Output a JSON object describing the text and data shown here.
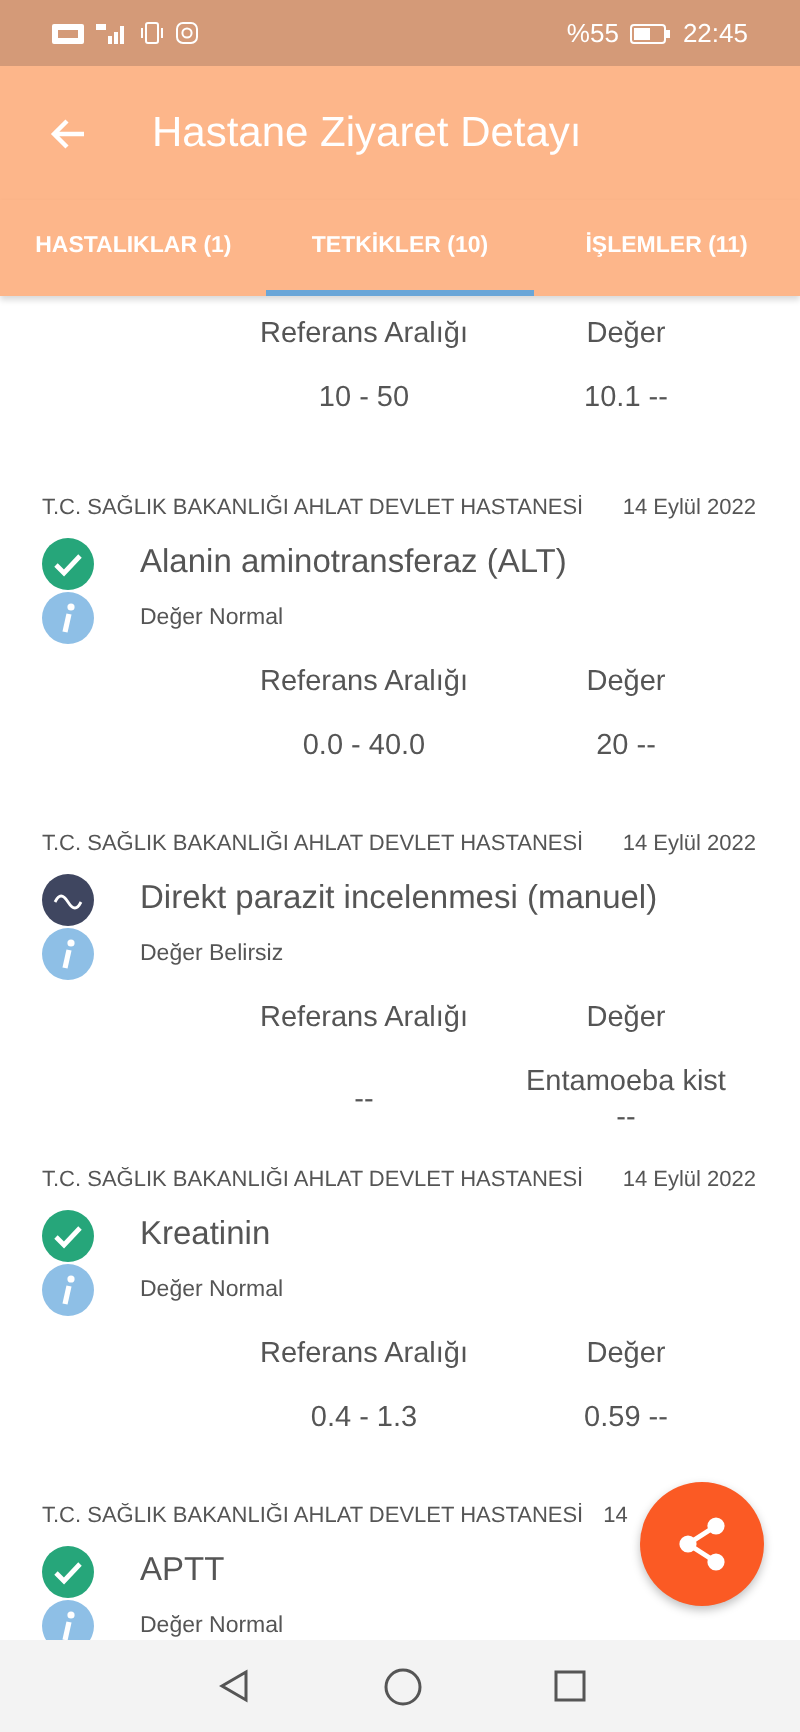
{
  "status_bar": {
    "battery": "%55",
    "time": "22:45"
  },
  "app_bar": {
    "title": "Hastane Ziyaret Detayı"
  },
  "tabs": [
    {
      "label": "HASTALIKLAR (1)",
      "selected": false
    },
    {
      "label": "TETKİKLER (10)",
      "selected": true
    },
    {
      "label": "İŞLEMLER (11)",
      "selected": false
    }
  ],
  "tests": [
    {
      "reference_header": "Referans Aralığı",
      "value_header": "Değer",
      "reference": "10 - 50",
      "value": "10.1 --"
    },
    {
      "hospital": "T.C. SAĞLIK BAKANLIĞI AHLAT DEVLET HASTANESİ",
      "date": "14 Eylül 2022",
      "name": "Alanin aminotransferaz (ALT)",
      "kind": "normal",
      "status_text": "Değer Normal",
      "reference_header": "Referans Aralığı",
      "value_header": "Değer",
      "reference": "0.0 - 40.0",
      "value": "20 --"
    },
    {
      "hospital": "T.C. SAĞLIK BAKANLIĞI AHLAT DEVLET HASTANESİ",
      "date": "14 Eylül 2022",
      "name": "Direkt parazit incelenmesi (manuel)",
      "kind": "uncertain",
      "status_text": "Değer Belirsiz",
      "reference_header": "Referans Aralığı",
      "value_header": "Değer",
      "reference": "--",
      "value": "Entamoeba kist\n--"
    },
    {
      "hospital": "T.C. SAĞLIK BAKANLIĞI AHLAT DEVLET HASTANESİ",
      "date": "14 Eylül 2022",
      "name": "Kreatinin",
      "kind": "normal",
      "status_text": "Değer Normal",
      "reference_header": "Referans Aralığı",
      "value_header": "Değer",
      "reference": "0.4 - 1.3",
      "value": "0.59 --"
    },
    {
      "hospital": "T.C. SAĞLIK BAKANLIĞI AHLAT DEVLET HASTANESİ",
      "date": "14",
      "name": "APTT",
      "kind": "normal",
      "status_text": "Değer Normal"
    }
  ]
}
